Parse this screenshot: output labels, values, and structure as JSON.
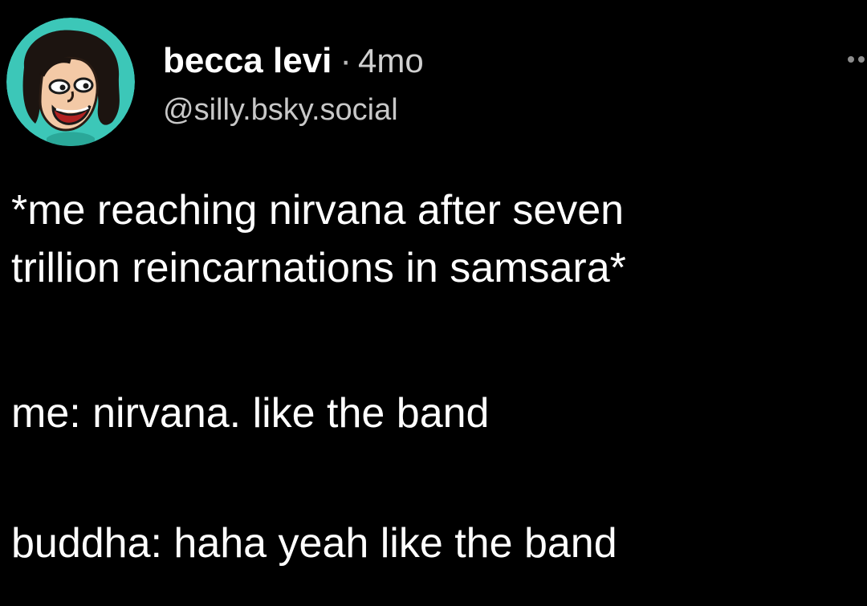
{
  "post": {
    "author": {
      "display_name": "becca levi",
      "separator": "·",
      "timestamp": "4mo",
      "handle": "@silly.bsky.social"
    },
    "avatar": {
      "icon": "cartoon-avatar-icon",
      "background_color": "#3cc7b8"
    },
    "menu_icon": "more-options-icon",
    "body": {
      "paragraph_1_line_1": "*me reaching nirvana after seven",
      "paragraph_1_line_2": "trillion reincarnations in samsara*",
      "paragraph_2": "me: nirvana. like the band",
      "paragraph_3": "buddha: haha yeah like the band"
    }
  },
  "colors": {
    "background": "#000000",
    "text_primary": "#ffffff",
    "text_secondary": "#c8c8c8"
  }
}
